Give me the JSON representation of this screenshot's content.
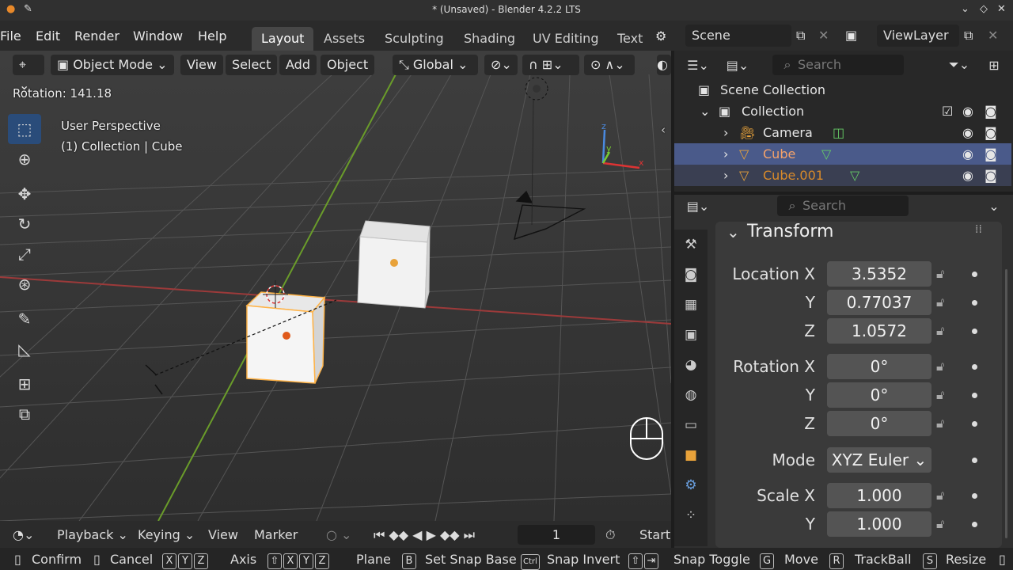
{
  "window": {
    "title": "* (Unsaved) - Blender 4.2.2 LTS",
    "controls": [
      "⌄",
      "◇",
      "✕"
    ]
  },
  "menu": [
    "File",
    "Edit",
    "Render",
    "Window",
    "Help"
  ],
  "workspaces": [
    "Layout",
    "Assets",
    "Sculpting",
    "Shading",
    "UV Editing",
    "Text"
  ],
  "scene": {
    "label": "Scene",
    "viewlayer": "ViewLayer"
  },
  "viewport": {
    "mode": "Object Mode",
    "menus": [
      "View",
      "Select",
      "Add",
      "Object"
    ],
    "orientation": "Global",
    "operator_info": "Rotation: 141.18",
    "perspective": "User Perspective",
    "context": "(1) Collection | Cube",
    "gizmo_axes": {
      "x": "x",
      "y": "y",
      "z": "z"
    }
  },
  "outliner": {
    "search_placeholder": "Search",
    "rows": [
      {
        "label": "Scene Collection"
      },
      {
        "label": "Collection"
      },
      {
        "label": "Camera"
      },
      {
        "label": "Cube"
      },
      {
        "label": "Cube.001"
      }
    ]
  },
  "properties": {
    "search_placeholder": "Search",
    "panel_title": "Transform",
    "location": {
      "label_x": "Location X",
      "label_y": "Y",
      "label_z": "Z",
      "x": "3.5352",
      "y": "0.77037",
      "z": "1.0572"
    },
    "rotation": {
      "label_x": "Rotation X",
      "label_y": "Y",
      "label_z": "Z",
      "x": "0°",
      "y": "0°",
      "z": "0°"
    },
    "mode": {
      "label": "Mode",
      "value": "XYZ Euler"
    },
    "scale": {
      "label_x": "Scale X",
      "label_y": "Y",
      "x": "1.000",
      "y": "1.000"
    }
  },
  "timeline": {
    "playback": "Playback",
    "keying": "Keying",
    "view": "View",
    "marker": "Marker",
    "frame": "1",
    "start": "Start"
  },
  "status": {
    "confirm": "Confirm",
    "cancel": "Cancel",
    "x_key": "X",
    "y_key": "Y",
    "z_key": "Z",
    "axis": "Axis",
    "plane": "Plane",
    "b_key": "B",
    "snap_base": "Set Snap Base",
    "ctrl_key": "Ctrl",
    "snap_invert": "Snap Invert",
    "snap_toggle": "Snap Toggle",
    "g_key": "G",
    "move": "Move",
    "r_key": "R",
    "trackball": "TrackBall",
    "s_key": "S",
    "resize": "Resize"
  },
  "colors": {
    "selected_row": "#4a5a8a",
    "accent_orange": "#e8a23a",
    "grid_red": "#9c3a3a",
    "grid_green": "#6a9c2a"
  }
}
